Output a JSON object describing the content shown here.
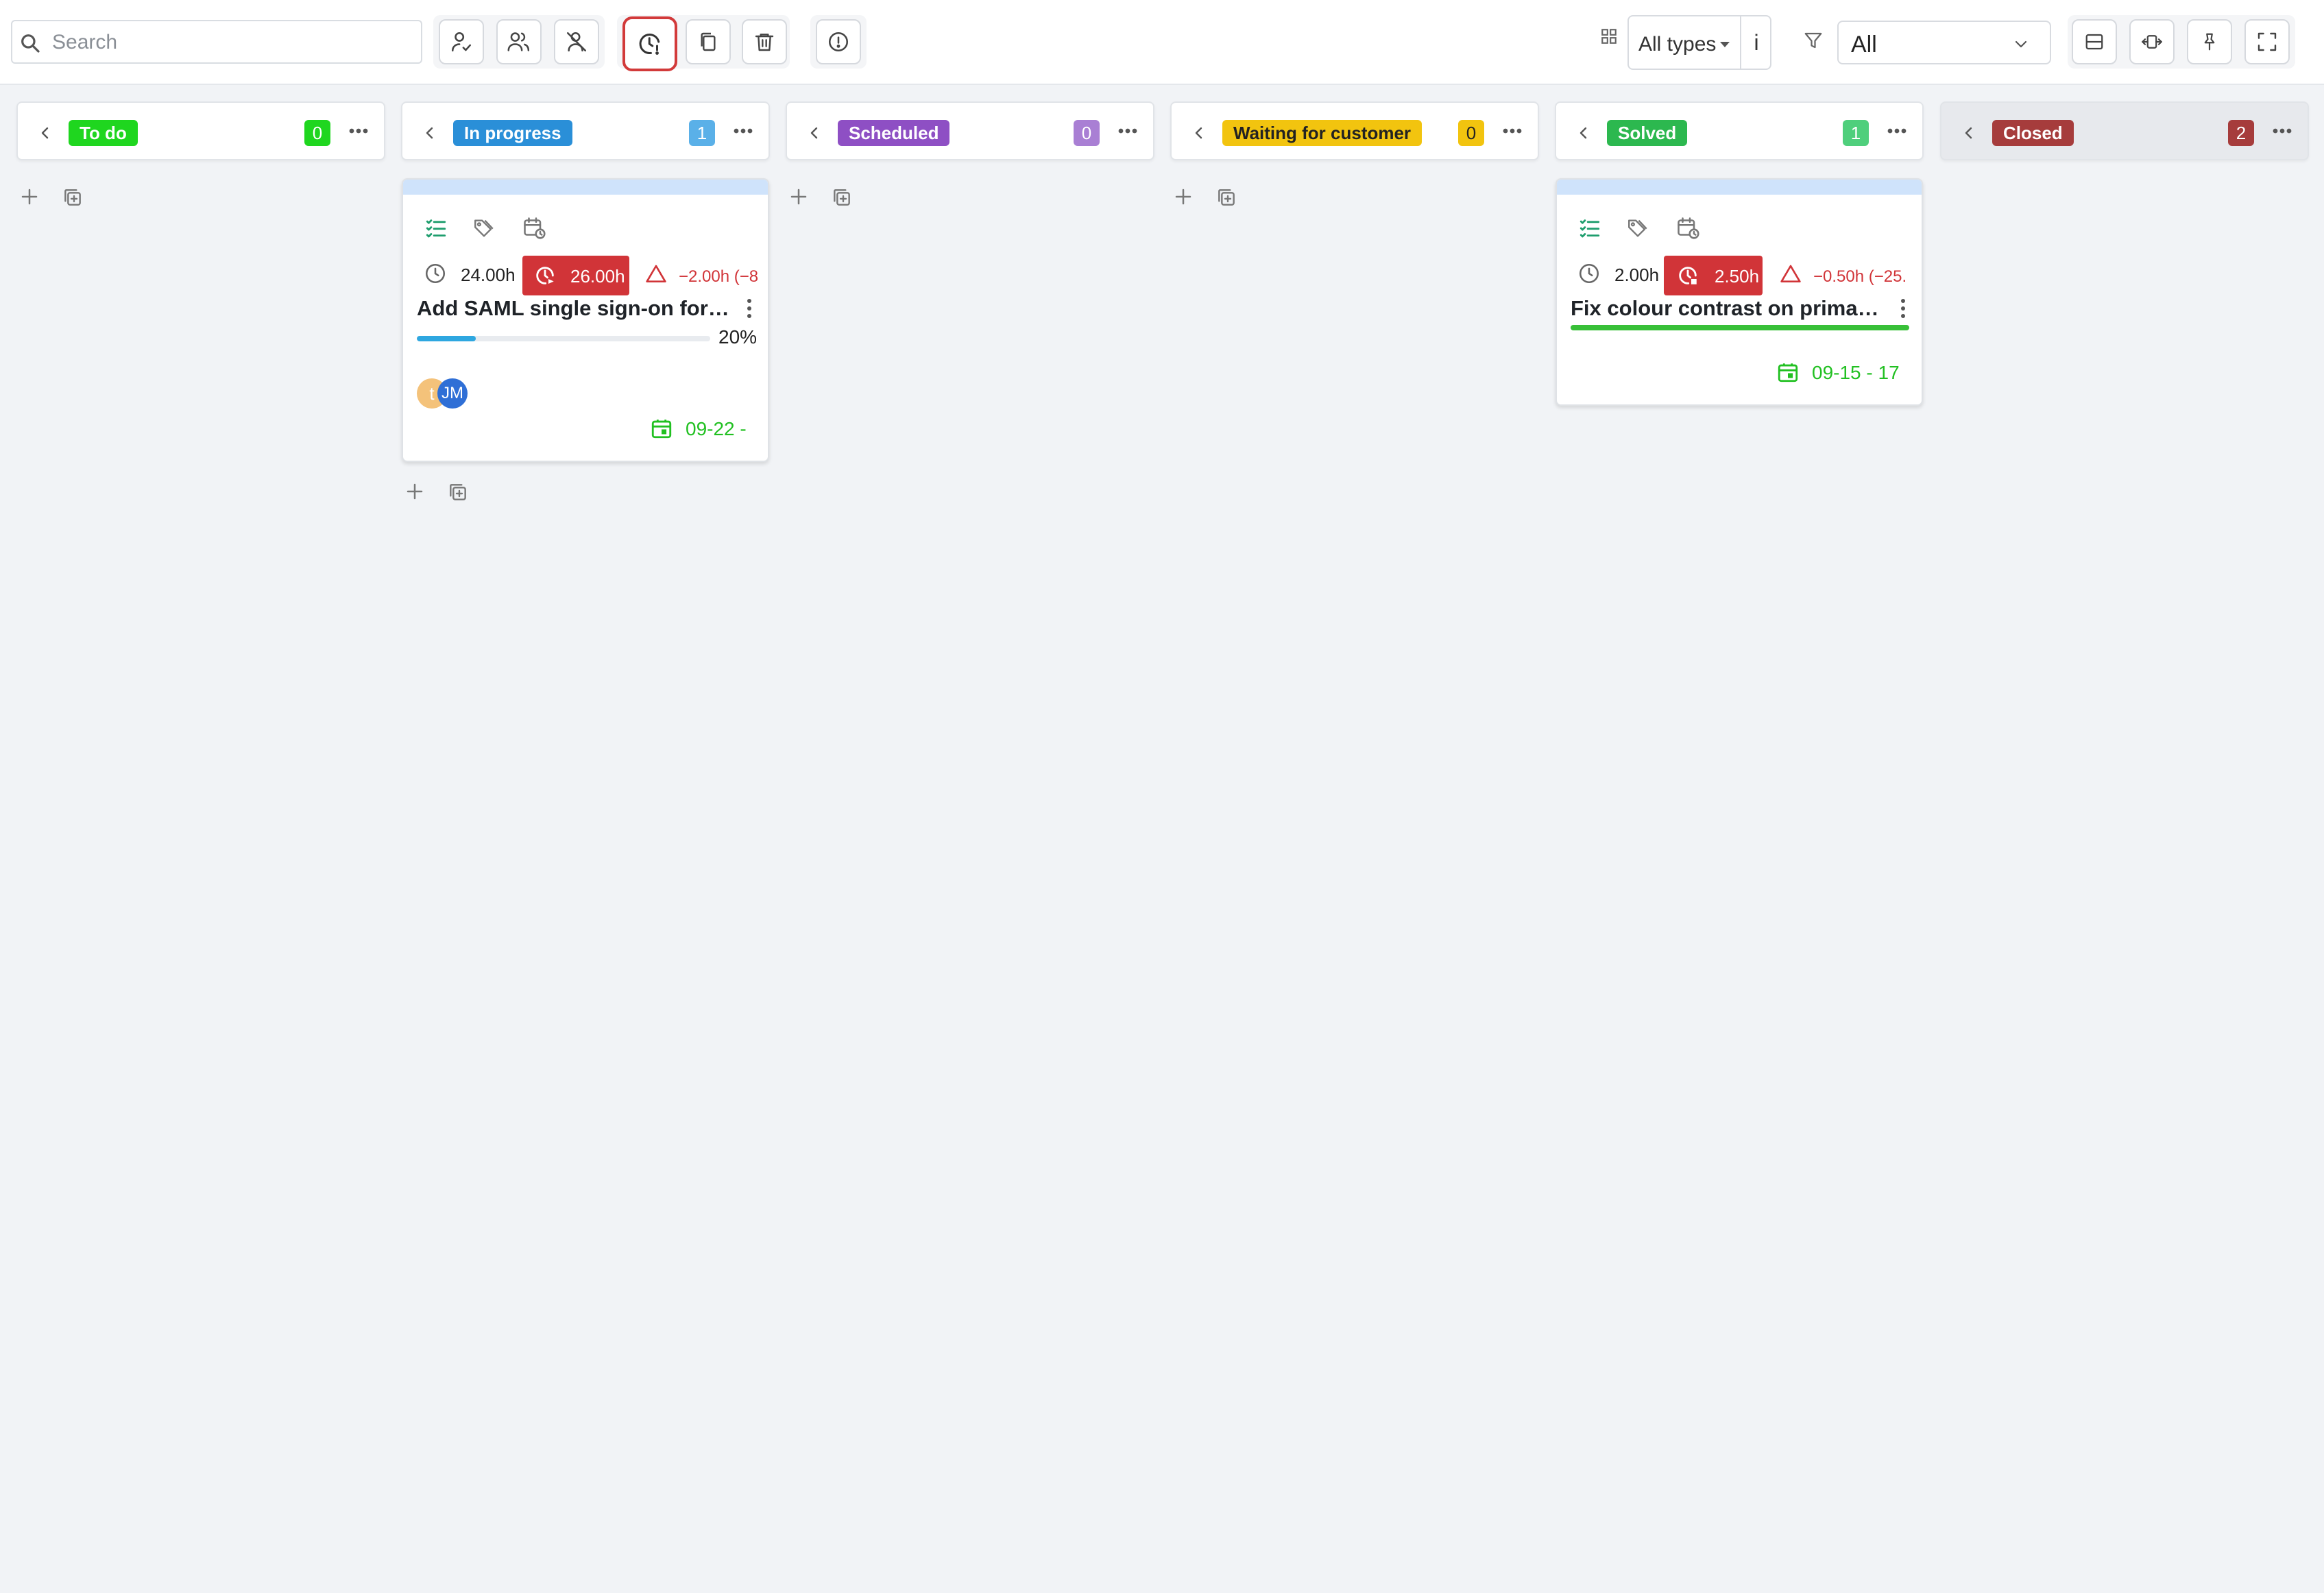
{
  "toolbar": {
    "search_placeholder": "Search",
    "type_filter": "All types",
    "type_info": "i",
    "status_filter": "All"
  },
  "columns": [
    {
      "name": "To do",
      "count": "0",
      "badge_color": "#1fd61f",
      "count_color": "#1fd61f"
    },
    {
      "name": "In progress",
      "count": "1",
      "badge_color": "#2a8fd8",
      "count_color": "#5ab0e8"
    },
    {
      "name": "Scheduled",
      "count": "0",
      "badge_color": "#8e4fc4",
      "count_color": "#a97fd4"
    },
    {
      "name": "Waiting for customer",
      "count": "0",
      "badge_color": "#f2c40f",
      "count_color": "#f2c40f"
    },
    {
      "name": "Solved",
      "count": "1",
      "badge_color": "#2cb84f",
      "count_color": "#4fcf7c"
    },
    {
      "name": "Closed",
      "count": "2",
      "badge_color": "#a63c3c",
      "count_color": "#a63c3c"
    }
  ],
  "cards": [
    {
      "estimate": "24.00h",
      "spent": "26.00h",
      "overrun": "−2.00h (−8",
      "title": "Add SAML single sign-on for staf...",
      "progress": 0.2,
      "progress_label": "20%",
      "assignees": [
        "t",
        "JM"
      ],
      "date": "09-22 -"
    },
    {
      "estimate": "2.00h",
      "spent": "2.50h",
      "overrun": "−0.50h (−25.",
      "title": "Fix colour contrast on primary b...",
      "date": "09-15 - 17"
    }
  ],
  "colors": {
    "accent_red": "#d13438",
    "date_green": "#21c021",
    "progress_blue": "#2ea7e0",
    "done_green": "#38c038",
    "checklist_teal": "#1f9e6e",
    "active_outline": "#d23a3a"
  },
  "icons": {
    "search": "search-icon",
    "assigned_to_me": "user-check-icon",
    "team": "users-icon",
    "unassigned": "user-slash-icon",
    "time_tracking": "clock-alert-icon",
    "copy": "copy-icon",
    "delete": "trash-icon",
    "info": "alert-circle-icon",
    "grid": "grid-icon",
    "filter": "filter-icon",
    "compact": "rows-icon",
    "expand": "arrows-horizontal-icon",
    "pin": "pin-icon",
    "fullscreen": "fullscreen-icon"
  }
}
